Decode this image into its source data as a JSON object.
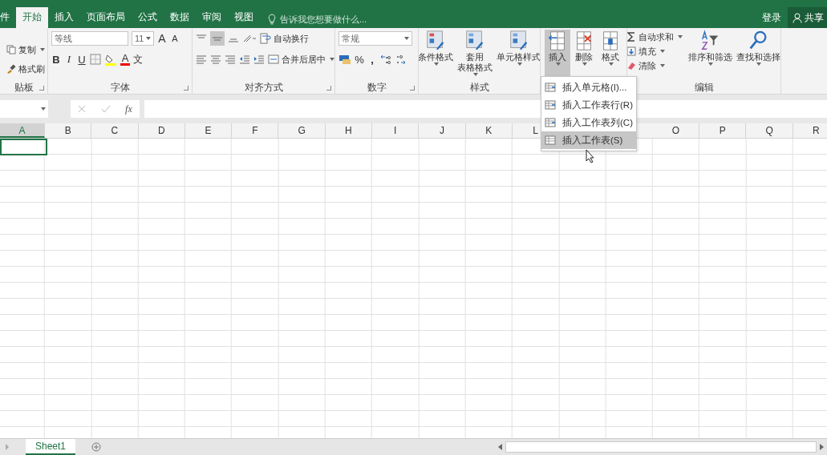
{
  "tabs": [
    {
      "label": "件",
      "selected": false
    },
    {
      "label": "开始",
      "selected": true
    },
    {
      "label": "插入",
      "selected": false
    },
    {
      "label": "页面布局",
      "selected": false
    },
    {
      "label": "公式",
      "selected": false
    },
    {
      "label": "数据",
      "selected": false
    },
    {
      "label": "审阅",
      "selected": false
    },
    {
      "label": "视图",
      "selected": false
    }
  ],
  "tell_me": {
    "placeholder": "告诉我您想要做什么..."
  },
  "account": {
    "sign_in": "登录",
    "share": "共享"
  },
  "ribbon": {
    "clipboard": {
      "label": "贴板",
      "buttons": [
        "复制",
        "格式刷"
      ]
    },
    "font": {
      "label": "字体",
      "font_name": "等线",
      "font_size": "11",
      "grow": "A",
      "shrink": "A",
      "styles": [
        "B",
        "I",
        "U"
      ],
      "font_color": "A",
      "phonetic": "文"
    },
    "alignment": {
      "label": "对齐方式",
      "wrap_text": "自动换行",
      "merge_center": "合并后居中"
    },
    "number": {
      "label": "数字",
      "format": "常规",
      "percent": "%",
      "comma": ","
    },
    "styles": {
      "label": "样式",
      "buttons": [
        {
          "lines": [
            "条件格式"
          ]
        },
        {
          "lines": [
            "套用",
            "表格格式"
          ]
        },
        {
          "lines": [
            "单元格样式"
          ]
        }
      ]
    },
    "cells": {
      "buttons": [
        {
          "label": "插入",
          "selected": true
        },
        {
          "label": "删除",
          "selected": false
        },
        {
          "label": "格式",
          "selected": false
        }
      ]
    },
    "editing": {
      "label": "编辑",
      "small_buttons": [
        "自动求和",
        "填充",
        "清除"
      ],
      "buttons": [
        "排序和筛选",
        "查找和选择"
      ]
    }
  },
  "formula_bar": {
    "function_symbol": "fx"
  },
  "columns": [
    {
      "label": "A",
      "selected": true
    },
    {
      "label": "B",
      "selected": false
    },
    {
      "label": "C",
      "selected": false
    },
    {
      "label": "D",
      "selected": false
    },
    {
      "label": "E",
      "selected": false
    },
    {
      "label": "F",
      "selected": false
    },
    {
      "label": "G",
      "selected": false
    },
    {
      "label": "H",
      "selected": false
    },
    {
      "label": "I",
      "selected": false
    },
    {
      "label": "J",
      "selected": false
    },
    {
      "label": "K",
      "selected": false
    },
    {
      "label": "L",
      "selected": false
    },
    {
      "label": "O",
      "selected": false,
      "gap_before": true
    },
    {
      "label": "P",
      "selected": false
    },
    {
      "label": "Q",
      "selected": false
    },
    {
      "label": "R",
      "selected": false
    }
  ],
  "insert_menu": {
    "items": [
      {
        "label": "插入单元格(I)...",
        "selected": false
      },
      {
        "label": "插入工作表行(R)",
        "selected": false
      },
      {
        "label": "插入工作表列(C)",
        "selected": false
      },
      {
        "label": "插入工作表(S)",
        "selected": true
      }
    ]
  },
  "sheet_tabs": [
    {
      "label": "Sheet1",
      "selected": true
    }
  ]
}
